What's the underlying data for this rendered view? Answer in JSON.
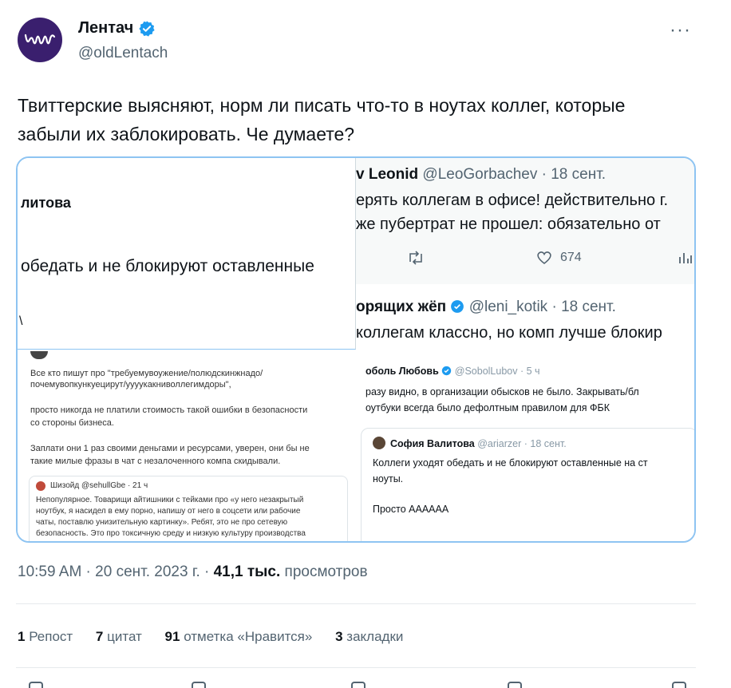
{
  "author": {
    "name": "Лентач",
    "handle": "@oldLentach"
  },
  "tweet": {
    "text": "Твиттерские выясняют, норм ли писать что-то в ноутах коллег, которые забыли их заблокировать. Че думаете?"
  },
  "media": {
    "top_left": {
      "name": "литова",
      "line": "обедать и не блокируют оставленные",
      "tick": "\\"
    },
    "top_right": {
      "name": "v Leonid",
      "handle": "@LeoGorbachev · 18 сент.",
      "line1": "ерять коллегам в офисе! действительно г.",
      "line2": "же пубертрат не прошел: обязательно от",
      "likes": "674"
    },
    "top_right2": {
      "name": "орящих жёп",
      "handle": "@leni_kotik · 18 сент.",
      "line1": "коллегам классно, но комп лучше блокир"
    },
    "bottom_left": {
      "lines": [
        "Все кто пишут про \"требуемувоужение/полюдскинжнадо/",
        "почемувопкункуецирут/уууукакниволлегимдоры\",",
        "просто никогда не платили стоимость такой ошибки в безопасности",
        "со стороны бизнеса.",
        "Заплати они 1 раз своими деньгами и ресурсами, уверен, они бы не",
        "такие милые фразы в чат с незалоченного компа скидывали."
      ],
      "quote_author": "Шизойд @sehullGbe · 21 ч",
      "quote_lines": [
        "Непопулярное. Товарищи айтишники с тейками про «у него незакрытый",
        "ноутбук, я насидел в ему порно, напишу от него в соцсети или рабочие",
        "чаты, поставлю унизительную картинку». Ребят, это не про сетевую",
        "безопасность. Это про токсичную среду и низкую культуру производства"
      ]
    },
    "bottom_right": {
      "author": "оболь Любовь",
      "handle": "@SobolLubov · 5 ч",
      "line1": "разу видно, в организации обысков не было. Закрывать/бл",
      "line2": "оутбуки всегда было дефолтным правилом для ФБК",
      "inner_author": "София Валитова",
      "inner_handle": "@ariarzer · 18 сент.",
      "inner_line1": "Коллеги уходят обедать и не блокируют оставленные на ст",
      "inner_line2": "ноуты.",
      "inner_line3": "Просто АААААА"
    }
  },
  "meta": {
    "time": "10:59 AM · 20 сент. 2023 г. · ",
    "views_count": "41,1 тыс.",
    "views_label": " просмотров"
  },
  "stats": {
    "reposts_count": "1",
    "reposts_label": " Репост",
    "quotes_count": "7",
    "quotes_label": " цитат",
    "likes_count": "91",
    "likes_label": " отметка «Нравится»",
    "bookmarks_count": "3",
    "bookmarks_label": " закладки"
  },
  "colors": {
    "accent": "#1d9bf0",
    "avatar_bg": "#3a1f6e",
    "media_border": "#8ec4f2"
  }
}
